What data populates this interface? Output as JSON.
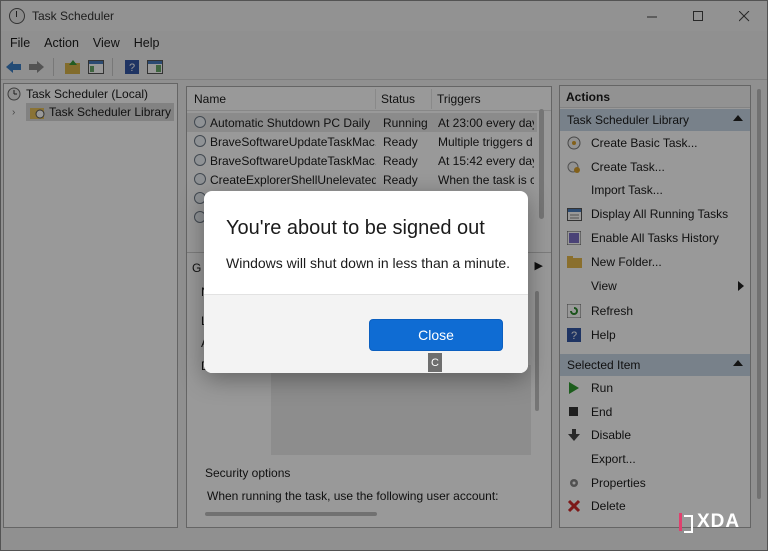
{
  "window": {
    "title": "Task Scheduler"
  },
  "menu": [
    "File",
    "Action",
    "View",
    "Help"
  ],
  "tree": {
    "root": "Task Scheduler (Local)",
    "child": "Task Scheduler Library"
  },
  "tasks": {
    "columns": [
      "Name",
      "Status",
      "Triggers"
    ],
    "rows": [
      {
        "name": "Automatic Shutdown PC Daily",
        "status": "Running",
        "trigger": "At 23:00 every day"
      },
      {
        "name": "BraveSoftwareUpdateTaskMac...",
        "status": "Ready",
        "trigger": "Multiple triggers d"
      },
      {
        "name": "BraveSoftwareUpdateTaskMac...",
        "status": "Ready",
        "trigger": "At 15:42 every day"
      },
      {
        "name": "CreateExplorerShellUnelevated...",
        "status": "Ready",
        "trigger": "When the task is c"
      }
    ]
  },
  "details": {
    "tab_fragment": "G",
    "left_fragments": [
      "N",
      "L",
      "A",
      "D"
    ],
    "security_label": "Security options",
    "security_line": "When running the task, use the following user account:"
  },
  "actions": {
    "title": "Actions",
    "group1": "Task Scheduler Library",
    "group1_items": [
      {
        "label": "Create Basic Task...",
        "icon": "create-basic-task-icon"
      },
      {
        "label": "Create Task...",
        "icon": "create-task-icon"
      },
      {
        "label": "Import Task...",
        "icon": "import-icon"
      },
      {
        "label": "Display All Running Tasks",
        "icon": "display-tasks-icon"
      },
      {
        "label": "Enable All Tasks History",
        "icon": "history-icon"
      },
      {
        "label": "New Folder...",
        "icon": "folder-icon"
      },
      {
        "label": "View",
        "icon": "none"
      },
      {
        "label": "Refresh",
        "icon": "refresh-icon"
      },
      {
        "label": "Help",
        "icon": "help-icon"
      }
    ],
    "group2": "Selected Item",
    "group2_items": [
      {
        "label": "Run",
        "icon": "run-icon"
      },
      {
        "label": "End",
        "icon": "end-icon"
      },
      {
        "label": "Disable",
        "icon": "disable-icon"
      },
      {
        "label": "Export...",
        "icon": "none"
      },
      {
        "label": "Properties",
        "icon": "properties-icon"
      },
      {
        "label": "Delete",
        "icon": "delete-icon"
      }
    ]
  },
  "dialog": {
    "title": "You're about to be signed out",
    "message": "Windows will shut down in less than a minute.",
    "close_label": "Close",
    "access_key": "C"
  },
  "watermark": {
    "text": "XDA"
  },
  "colors": {
    "accent": "#0f6cd3",
    "group_header": "#c8d7e7",
    "watermark_red": "#e0406e"
  }
}
